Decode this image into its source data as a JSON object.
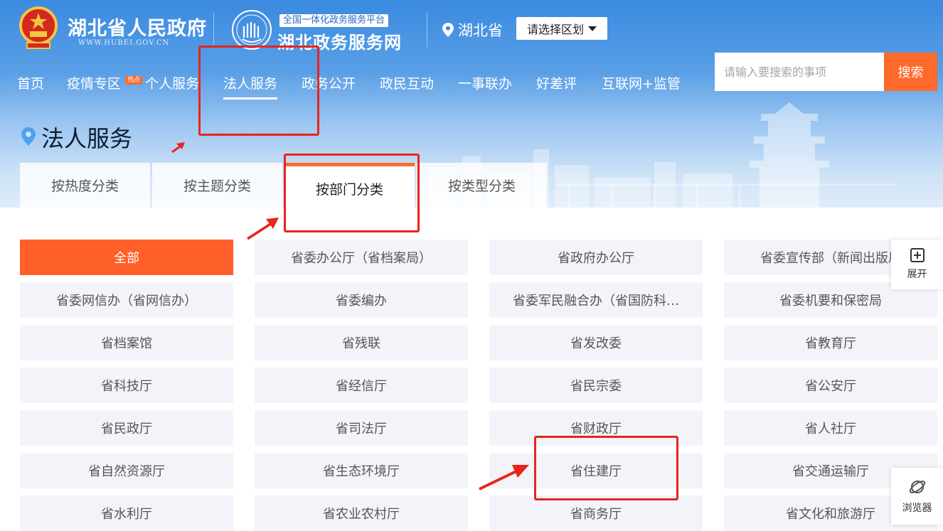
{
  "header": {
    "site_name": "湖北省人民政府",
    "site_url": "WWW.HUBEI.GOV.CN",
    "platform_tag": "全国一体化政务服务平台",
    "platform_name": "湖北政务服务网",
    "location": "湖北省",
    "region_select": "请选择区划"
  },
  "nav": {
    "items": [
      "首页",
      "疫情专区",
      "个人服务",
      "法人服务",
      "政务公开",
      "政民互动",
      "一事联办",
      "好差评",
      "互联网+监管"
    ],
    "hot_badge": "热点",
    "active": "法人服务"
  },
  "search": {
    "placeholder": "请输入要搜索的事项",
    "button": "搜索"
  },
  "page": {
    "title": "法人服务"
  },
  "tabs": [
    "按热度分类",
    "按主题分类",
    "按部门分类",
    "按类型分类"
  ],
  "active_tab": "按部门分类",
  "departments": [
    "全部",
    "省委办公厅（省档案局）",
    "省政府办公厅",
    "省委宣传部（新闻出版局",
    "省委网信办（省网信办）",
    "省委编办",
    "省委军民融合办（省国防科…",
    "省委机要和保密局",
    "省档案馆",
    "省残联",
    "省发改委",
    "省教育厅",
    "省科技厅",
    "省经信厅",
    "省民宗委",
    "省公安厅",
    "省民政厅",
    "省司法厅",
    "省财政厅",
    "省人社厅",
    "省自然资源厅",
    "省生态环境厅",
    "省住建厅",
    "省交通运输厅",
    "省水利厅",
    "省农业农村厅",
    "省商务厅",
    "省文化和旅游厅"
  ],
  "selected_department": "全部",
  "side": {
    "expand": "展开",
    "browser": "浏览器"
  },
  "colors": {
    "accent": "#ff6a2a",
    "header_blue": "#3a8ae0",
    "annotation": "#e8241c"
  }
}
